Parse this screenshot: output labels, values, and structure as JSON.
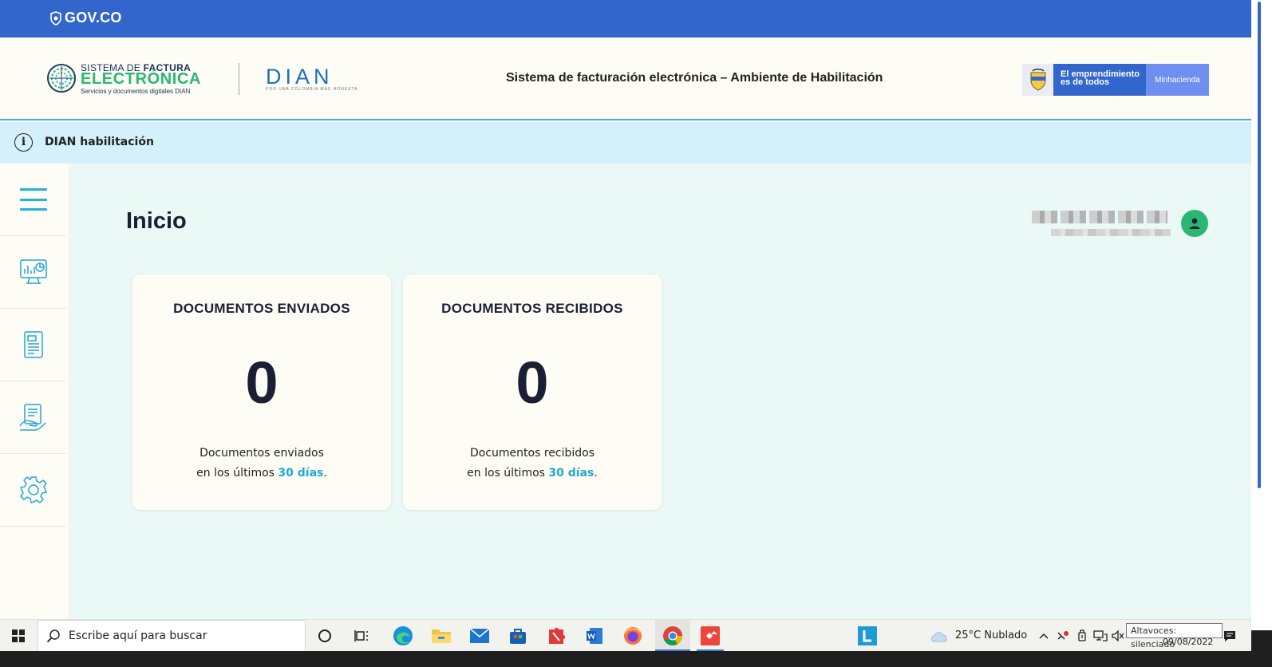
{
  "govbar": {
    "logo_text": "GOV.CO"
  },
  "header": {
    "sf_logo": {
      "line1_a": "SISTEMA DE ",
      "line1_b": "FACTURA",
      "line2": "ELECTRÓNICA",
      "line3": "Servicios y documentos digitales DIAN"
    },
    "dian_logo": {
      "word": "DIAN",
      "tag": "POR UNA COLOMBIA MÁS HONESTA"
    },
    "system_title": "Sistema de facturación electrónica – Ambiente de Habilitación",
    "minhacienda": {
      "slogan_line1": "El emprendimiento",
      "slogan_line2": "es de todos",
      "name": "Minhacienda"
    }
  },
  "infobar": {
    "text": "DIAN habilitación"
  },
  "sidebar": {
    "items": [
      {
        "icon": "menu-icon"
      },
      {
        "icon": "dashboard-monitor-icon"
      },
      {
        "icon": "document-list-icon"
      },
      {
        "icon": "hand-document-icon"
      },
      {
        "icon": "gear-icon"
      }
    ]
  },
  "main": {
    "title": "Inicio",
    "cards": [
      {
        "title": "DOCUMENTOS ENVIADOS",
        "value": "0",
        "desc1": "Documentos enviados",
        "desc2_pre": "en los últimos ",
        "desc2_hl": "30 días",
        "desc2_post": "."
      },
      {
        "title": "DOCUMENTOS RECIBIDOS",
        "value": "0",
        "desc1": "Documentos recibidos",
        "desc2_pre": "en los últimos ",
        "desc2_hl": "30 días",
        "desc2_post": "."
      }
    ]
  },
  "taskbar": {
    "search_placeholder": "Escribe aquí para buscar",
    "weather": "25°C  Nublado",
    "tooltip": "Altavoces: silenciado",
    "date": "09/08/2022"
  },
  "colors": {
    "gov_blue": "#3366cc",
    "accent_cyan": "#22b0dd",
    "green": "#2bb673",
    "navy": "#1c1f33"
  }
}
